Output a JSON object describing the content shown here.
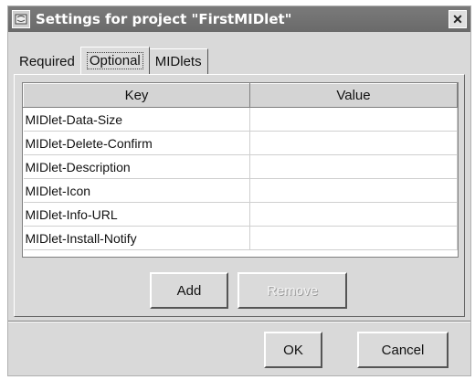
{
  "window": {
    "title": "Settings for project \"FirstMIDlet\"",
    "close_symbol": "✕"
  },
  "tabs": [
    {
      "label": "Required"
    },
    {
      "label": "Optional"
    },
    {
      "label": "MIDlets"
    }
  ],
  "table": {
    "headers": [
      "Key",
      "Value"
    ],
    "rows": [
      {
        "key": "MIDlet-Data-Size",
        "value": ""
      },
      {
        "key": "MIDlet-Delete-Confirm",
        "value": ""
      },
      {
        "key": "MIDlet-Description",
        "value": ""
      },
      {
        "key": "MIDlet-Icon",
        "value": ""
      },
      {
        "key": "MIDlet-Info-URL",
        "value": ""
      },
      {
        "key": "MIDlet-Install-Notify",
        "value": ""
      }
    ]
  },
  "buttons": {
    "add": "Add",
    "remove": "Remove",
    "ok": "OK",
    "cancel": "Cancel"
  },
  "icons": {
    "title_icon": "window-app-icon",
    "close_icon": "close-icon"
  },
  "colors": {
    "titlebar": "#6f6f6f",
    "dialog_bg": "#d9d9d9"
  }
}
